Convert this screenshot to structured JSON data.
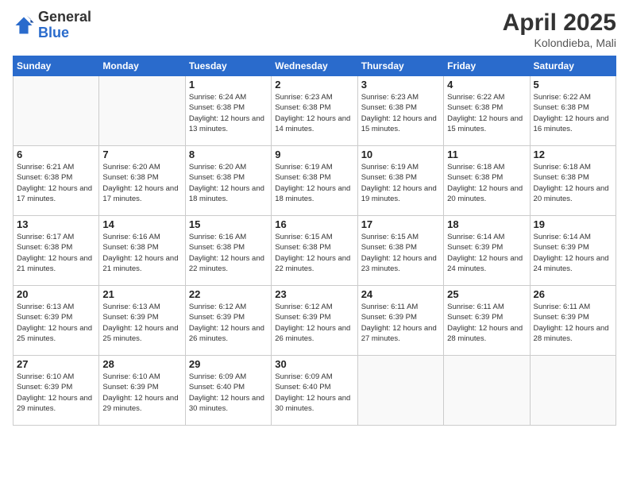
{
  "header": {
    "logo_general": "General",
    "logo_blue": "Blue",
    "month_title": "April 2025",
    "location": "Kolondieba, Mali"
  },
  "weekdays": [
    "Sunday",
    "Monday",
    "Tuesday",
    "Wednesday",
    "Thursday",
    "Friday",
    "Saturday"
  ],
  "weeks": [
    [
      {
        "day": "",
        "info": ""
      },
      {
        "day": "",
        "info": ""
      },
      {
        "day": "1",
        "info": "Sunrise: 6:24 AM\nSunset: 6:38 PM\nDaylight: 12 hours and 13 minutes."
      },
      {
        "day": "2",
        "info": "Sunrise: 6:23 AM\nSunset: 6:38 PM\nDaylight: 12 hours and 14 minutes."
      },
      {
        "day": "3",
        "info": "Sunrise: 6:23 AM\nSunset: 6:38 PM\nDaylight: 12 hours and 15 minutes."
      },
      {
        "day": "4",
        "info": "Sunrise: 6:22 AM\nSunset: 6:38 PM\nDaylight: 12 hours and 15 minutes."
      },
      {
        "day": "5",
        "info": "Sunrise: 6:22 AM\nSunset: 6:38 PM\nDaylight: 12 hours and 16 minutes."
      }
    ],
    [
      {
        "day": "6",
        "info": "Sunrise: 6:21 AM\nSunset: 6:38 PM\nDaylight: 12 hours and 17 minutes."
      },
      {
        "day": "7",
        "info": "Sunrise: 6:20 AM\nSunset: 6:38 PM\nDaylight: 12 hours and 17 minutes."
      },
      {
        "day": "8",
        "info": "Sunrise: 6:20 AM\nSunset: 6:38 PM\nDaylight: 12 hours and 18 minutes."
      },
      {
        "day": "9",
        "info": "Sunrise: 6:19 AM\nSunset: 6:38 PM\nDaylight: 12 hours and 18 minutes."
      },
      {
        "day": "10",
        "info": "Sunrise: 6:19 AM\nSunset: 6:38 PM\nDaylight: 12 hours and 19 minutes."
      },
      {
        "day": "11",
        "info": "Sunrise: 6:18 AM\nSunset: 6:38 PM\nDaylight: 12 hours and 20 minutes."
      },
      {
        "day": "12",
        "info": "Sunrise: 6:18 AM\nSunset: 6:38 PM\nDaylight: 12 hours and 20 minutes."
      }
    ],
    [
      {
        "day": "13",
        "info": "Sunrise: 6:17 AM\nSunset: 6:38 PM\nDaylight: 12 hours and 21 minutes."
      },
      {
        "day": "14",
        "info": "Sunrise: 6:16 AM\nSunset: 6:38 PM\nDaylight: 12 hours and 21 minutes."
      },
      {
        "day": "15",
        "info": "Sunrise: 6:16 AM\nSunset: 6:38 PM\nDaylight: 12 hours and 22 minutes."
      },
      {
        "day": "16",
        "info": "Sunrise: 6:15 AM\nSunset: 6:38 PM\nDaylight: 12 hours and 22 minutes."
      },
      {
        "day": "17",
        "info": "Sunrise: 6:15 AM\nSunset: 6:38 PM\nDaylight: 12 hours and 23 minutes."
      },
      {
        "day": "18",
        "info": "Sunrise: 6:14 AM\nSunset: 6:39 PM\nDaylight: 12 hours and 24 minutes."
      },
      {
        "day": "19",
        "info": "Sunrise: 6:14 AM\nSunset: 6:39 PM\nDaylight: 12 hours and 24 minutes."
      }
    ],
    [
      {
        "day": "20",
        "info": "Sunrise: 6:13 AM\nSunset: 6:39 PM\nDaylight: 12 hours and 25 minutes."
      },
      {
        "day": "21",
        "info": "Sunrise: 6:13 AM\nSunset: 6:39 PM\nDaylight: 12 hours and 25 minutes."
      },
      {
        "day": "22",
        "info": "Sunrise: 6:12 AM\nSunset: 6:39 PM\nDaylight: 12 hours and 26 minutes."
      },
      {
        "day": "23",
        "info": "Sunrise: 6:12 AM\nSunset: 6:39 PM\nDaylight: 12 hours and 26 minutes."
      },
      {
        "day": "24",
        "info": "Sunrise: 6:11 AM\nSunset: 6:39 PM\nDaylight: 12 hours and 27 minutes."
      },
      {
        "day": "25",
        "info": "Sunrise: 6:11 AM\nSunset: 6:39 PM\nDaylight: 12 hours and 28 minutes."
      },
      {
        "day": "26",
        "info": "Sunrise: 6:11 AM\nSunset: 6:39 PM\nDaylight: 12 hours and 28 minutes."
      }
    ],
    [
      {
        "day": "27",
        "info": "Sunrise: 6:10 AM\nSunset: 6:39 PM\nDaylight: 12 hours and 29 minutes."
      },
      {
        "day": "28",
        "info": "Sunrise: 6:10 AM\nSunset: 6:39 PM\nDaylight: 12 hours and 29 minutes."
      },
      {
        "day": "29",
        "info": "Sunrise: 6:09 AM\nSunset: 6:40 PM\nDaylight: 12 hours and 30 minutes."
      },
      {
        "day": "30",
        "info": "Sunrise: 6:09 AM\nSunset: 6:40 PM\nDaylight: 12 hours and 30 minutes."
      },
      {
        "day": "",
        "info": ""
      },
      {
        "day": "",
        "info": ""
      },
      {
        "day": "",
        "info": ""
      }
    ]
  ]
}
